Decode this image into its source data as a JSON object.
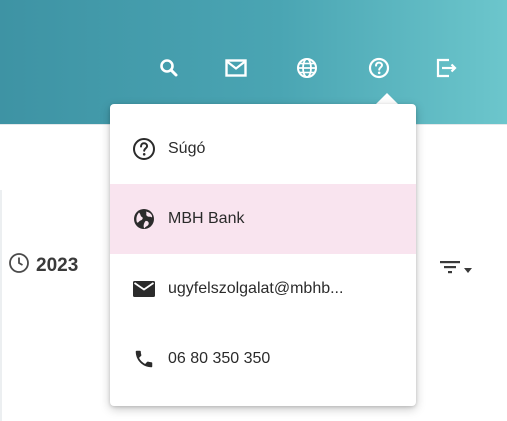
{
  "header": {
    "icons": [
      "search-icon",
      "mail-icon",
      "globe-icon",
      "help-icon",
      "logout-icon"
    ],
    "colors": {
      "start": "#3e93a4",
      "end": "#6cc6cc"
    }
  },
  "content": {
    "date_label": "2023"
  },
  "dropdown": {
    "items": [
      {
        "label": "Súgó",
        "icon": "help-circle-icon"
      },
      {
        "label": "MBH Bank",
        "icon": "globe-filled-icon",
        "active": true
      },
      {
        "label": "ugyfelszolgalat@mbhb...",
        "icon": "mail-filled-icon"
      },
      {
        "label": "06 80 350 350",
        "icon": "phone-icon"
      }
    ],
    "active_color": "#f9e4ef"
  }
}
